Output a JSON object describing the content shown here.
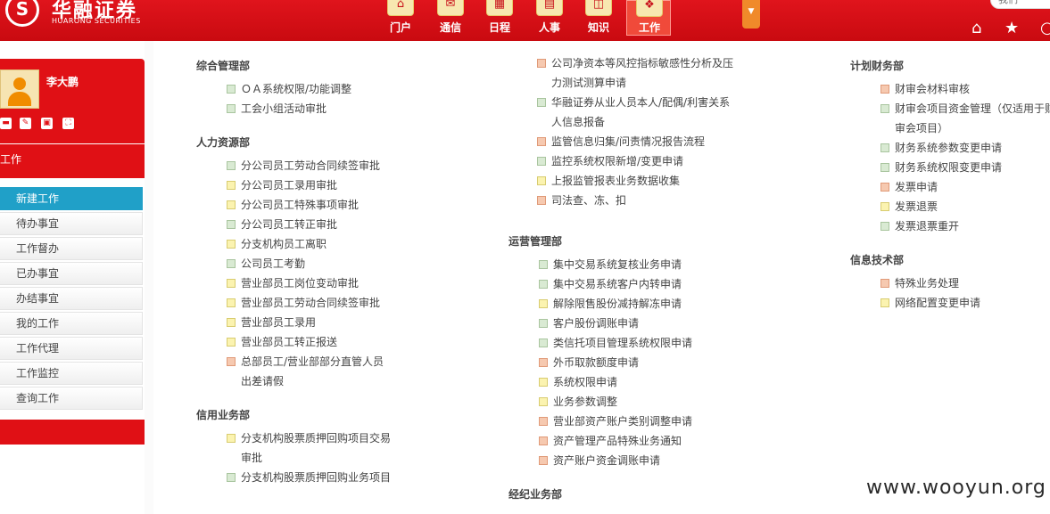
{
  "header": {
    "logo_cn": "华融证券",
    "logo_en": "HUARONG SECURITIES",
    "logo_mark": "S",
    "search_placeholder": "我们",
    "nav": [
      {
        "label": "门户",
        "icon": "home-icon",
        "glyph": "⌂"
      },
      {
        "label": "通信",
        "icon": "message-icon",
        "glyph": "✉"
      },
      {
        "label": "日程",
        "icon": "calendar-icon",
        "glyph": "▦"
      },
      {
        "label": "人事",
        "icon": "document-icon",
        "glyph": "▤"
      },
      {
        "label": "知识",
        "icon": "book-icon",
        "glyph": "◫"
      },
      {
        "label": "工作",
        "icon": "workflow-icon",
        "glyph": "❖",
        "active": true
      }
    ],
    "more_glyph": "▼",
    "icons": {
      "home": "⌂",
      "star": "★",
      "search": "○"
    }
  },
  "sidebar": {
    "user_name": "李大鹏",
    "user_icons": [
      "▬",
      "✎",
      "▣",
      "⛶"
    ],
    "section_title": "工作",
    "menu": [
      "新建工作",
      "待办事宜",
      "工作督办",
      "已办事宜",
      "办结事宜",
      "我的工作",
      "工作代理",
      "工作监控",
      "查询工作"
    ],
    "active_index": 0
  },
  "columns": {
    "col1": [
      {
        "dept": "综合管理部",
        "items": [
          {
            "text": "ＯＡ系统权限/功能调整",
            "color": "g"
          },
          {
            "text": "工会小组活动审批",
            "color": "g"
          }
        ]
      },
      {
        "dept": "人力资源部",
        "items": [
          {
            "text": "分公司员工劳动合同续签审批",
            "color": "g"
          },
          {
            "text": "分公司员工录用审批",
            "color": "y"
          },
          {
            "text": "分公司员工特殊事项审批",
            "color": "y"
          },
          {
            "text": "分公司员工转正审批",
            "color": "g"
          },
          {
            "text": "分支机构员工离职",
            "color": "y"
          },
          {
            "text": "公司员工考勤",
            "color": "g"
          },
          {
            "text": "营业部员工岗位变动审批",
            "color": "y"
          },
          {
            "text": "营业部员工劳动合同续签审批",
            "color": "y"
          },
          {
            "text": "营业部员工录用",
            "color": "y"
          },
          {
            "text": "营业部员工转正报送",
            "color": "y"
          },
          {
            "text": "总部员工/营业部部分直管人员出差请假",
            "color": "o"
          }
        ]
      },
      {
        "dept": "信用业务部",
        "items": [
          {
            "text": "分支机构股票质押回购项目交易审批",
            "color": "y"
          },
          {
            "text": "分支机构股票质押回购业务项目",
            "color": "g"
          }
        ]
      }
    ],
    "col2_top": [
      {
        "text": "公司净资本等风控指标敏感性分析及压力测试测算申请",
        "color": "o"
      },
      {
        "text": "华融证券从业人员本人/配偶/利害关系人信息报备",
        "color": "g"
      },
      {
        "text": "监管信息归集/问责情况报告流程",
        "color": "o"
      },
      {
        "text": "监控系统权限新增/变更申请",
        "color": "g"
      },
      {
        "text": "上报监管报表业务数据收集",
        "color": "y"
      },
      {
        "text": "司法查、冻、扣",
        "color": "o"
      }
    ],
    "col2": [
      {
        "dept": "运营管理部",
        "items": [
          {
            "text": "集中交易系统复核业务申请",
            "color": "g"
          },
          {
            "text": "集中交易系统客户内转申请",
            "color": "g"
          },
          {
            "text": "解除限售股份减持解冻申请",
            "color": "y"
          },
          {
            "text": "客户股份调账申请",
            "color": "g"
          },
          {
            "text": "类信托项目管理系统权限申请",
            "color": "g"
          },
          {
            "text": "外币取款额度申请",
            "color": "o"
          },
          {
            "text": "系统权限申请",
            "color": "y"
          },
          {
            "text": "业务参数调整",
            "color": "y"
          },
          {
            "text": "营业部资产账户类别调整申请",
            "color": "o"
          },
          {
            "text": "资产管理产品特殊业务通知",
            "color": "o"
          },
          {
            "text": "资产账户资金调账申请",
            "color": "o"
          }
        ]
      },
      {
        "dept": "经纪业务部",
        "items": []
      }
    ],
    "col3": [
      {
        "dept": "计划财务部",
        "items": [
          {
            "text": "财审会材料审核",
            "color": "o"
          },
          {
            "text": "财审会项目资金管理（仅适用于财审会项目）",
            "color": "g"
          },
          {
            "text": "财务系统参数变更申请",
            "color": "g"
          },
          {
            "text": "财务系统权限变更申请",
            "color": "g"
          },
          {
            "text": "发票申请",
            "color": "o"
          },
          {
            "text": "发票退票",
            "color": "y"
          },
          {
            "text": "发票退票重开",
            "color": "g"
          }
        ]
      },
      {
        "dept": "信息技术部",
        "items": [
          {
            "text": "特殊业务处理",
            "color": "o"
          },
          {
            "text": "网络配置变更申请",
            "color": "y"
          }
        ]
      }
    ]
  },
  "watermark": "www.wooyun.org"
}
